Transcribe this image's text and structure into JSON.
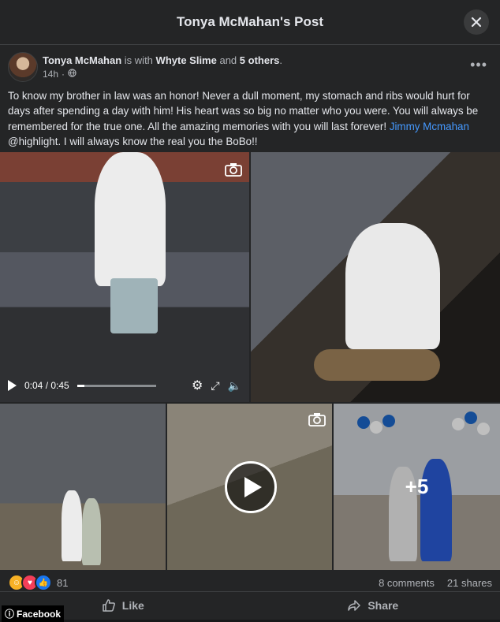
{
  "dialog": {
    "title": "Tonya McMahan's Post"
  },
  "author": {
    "name": "Tonya McMahan",
    "with_text": "is with",
    "tagged": "Whyte Slime",
    "and_text": "and",
    "others": "5 others",
    "period": ".",
    "time": "14h",
    "dot": "·"
  },
  "post": {
    "text": "To know my brother in law was an honor! Never a dull moment, my stomach and ribs would hurt for days after spending a day with him! His heart was so big no matter who you were. You will always be remembered for the true one. All the amazing memories with you will last forever! ",
    "mention": "Jimmy Mcmahan",
    "text_after": " @highlight. I will always know the real you the BoBo!!"
  },
  "video": {
    "time": "0:04 / 0:45",
    "progress": 0.09
  },
  "grid": {
    "more_count": "+5"
  },
  "stats": {
    "reactions": "81",
    "comments": "8 comments",
    "shares": "21 shares"
  },
  "actions": {
    "like": "Like",
    "share": "Share"
  },
  "watermark": {
    "label": "Facebook"
  },
  "colors": {
    "accent": "#4599ff",
    "bg": "#242526",
    "text": "#e4e6eb",
    "muted": "#b0b3b8"
  },
  "icons": [
    "close-icon",
    "globe-icon",
    "more-icon",
    "camera-icon",
    "play-icon",
    "settings-icon",
    "fullscreen-icon",
    "volume-icon",
    "like-icon",
    "share-icon"
  ]
}
